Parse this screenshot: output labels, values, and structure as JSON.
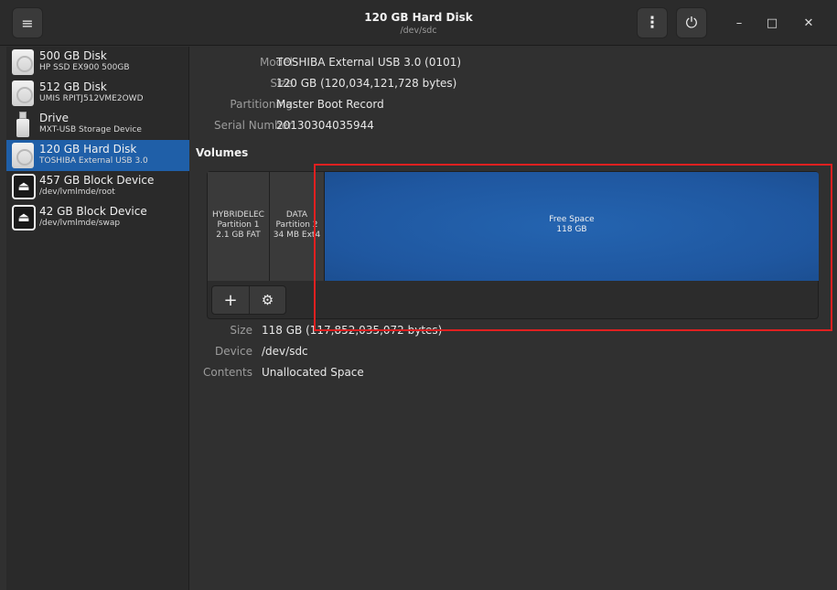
{
  "header": {
    "title": "120 GB Hard Disk",
    "subtitle": "/dev/sdc",
    "menu_icon": "≡",
    "more_icon": "⋮",
    "power_icon": "⏻",
    "minimize_icon": "–",
    "maximize_icon": "□",
    "close_icon": "✕"
  },
  "sidebar": {
    "items": [
      {
        "title": "500 GB Disk",
        "subtitle": "HP SSD EX900 500GB",
        "icon": "disk-icon"
      },
      {
        "title": "512 GB Disk",
        "subtitle": "UMIS RPITJ512VME2OWD",
        "icon": "disk-icon"
      },
      {
        "title": "Drive",
        "subtitle": "MXT-USB Storage Device",
        "icon": "usb-drive-icon"
      },
      {
        "title": "120 GB Hard Disk",
        "subtitle": "TOSHIBA External USB 3.0",
        "icon": "disk-icon",
        "selected": true
      },
      {
        "title": "457 GB Block Device",
        "subtitle": "/dev/lvmlmde/root",
        "icon": "eject-icon"
      },
      {
        "title": "42 GB Block Device",
        "subtitle": "/dev/lvmlmde/swap",
        "icon": "eject-icon"
      }
    ],
    "eject_glyph": "⏏"
  },
  "drive_info": {
    "model_label": "Model",
    "model_value": "TOSHIBA External USB 3.0 (0101)",
    "size_label": "Size",
    "size_value": "120 GB (120,034,121,728 bytes)",
    "partitioning_label": "Partitioning",
    "partitioning_value": "Master Boot Record",
    "serial_label": "Serial Number",
    "serial_value": "20130304035944"
  },
  "volumes": {
    "heading": "Volumes",
    "partitions": [
      {
        "name": "HYBRIDELEC",
        "number": "Partition 1",
        "detail": "2.1 GB FAT"
      },
      {
        "name": "DATA",
        "number": "Partition 2",
        "detail": "34 MB Ext4"
      },
      {
        "name": "Free Space",
        "detail": "118 GB"
      }
    ],
    "add_glyph": "+",
    "settings_glyph": "⚙"
  },
  "selected_volume": {
    "size_label": "Size",
    "size_value": "118 GB (117,852,035,072 bytes)",
    "device_label": "Device",
    "device_value": "/dev/sdc",
    "contents_label": "Contents",
    "contents_value": "Unallocated Space"
  },
  "colors": {
    "selection": "#1f5fa8",
    "free_space": "#2160aa",
    "highlight": "#e02020"
  }
}
